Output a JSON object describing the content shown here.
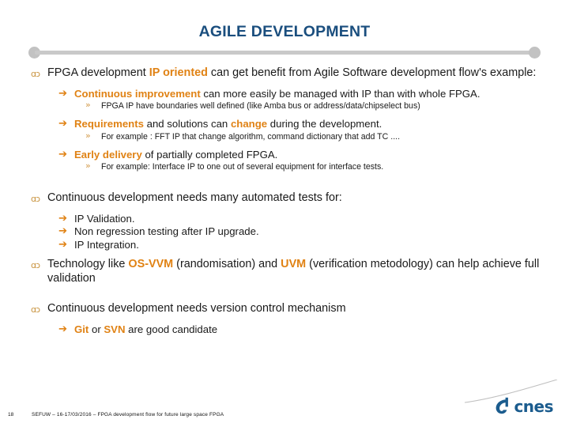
{
  "slide": {
    "title": "AGILE DEVELOPMENT",
    "page_number": "18",
    "footer_text": "SEFUW – 16-17/03/2016 – FPGA development flow for future large space FPGA"
  },
  "colors": {
    "title_blue": "#1A4E7E",
    "accent_orange": "#E08214",
    "bullet_gold": "#C8923C",
    "divider_gray": "#C9C9C9",
    "logo_blue": "#1B5C8E",
    "body_text": "#1A1A1A"
  },
  "icons": {
    "bullet_level1": "ɑɔ",
    "bullet_level2": "➔",
    "bullet_level3": "»"
  },
  "body": {
    "block1": {
      "lead_a": "FPGA development ",
      "lead_hl": "IP oriented",
      "lead_b": " can get benefit from  Agile Software development flow's example:",
      "items": [
        {
          "hl_lead": "Continuous improvement",
          "rest": " can more easily be managed with IP than with whole FPGA.",
          "sub": "FPGA IP have boundaries well defined (like Amba bus or address/data/chipselect bus)"
        },
        {
          "hl_lead": "Requirements",
          "mid": " and solutions can ",
          "hl_mid": "change",
          "rest": " during the development.",
          "sub": "For example : FFT IP that change algorithm, command dictionary that add TC ...."
        },
        {
          "hl_lead": "Early delivery",
          "rest": " of partially completed FPGA.",
          "sub": "For example: Interface IP to one out of several equipment for interface tests."
        }
      ]
    },
    "block2": {
      "lead": "Continuous development needs many automated tests for:",
      "items": [
        "IP Validation.",
        "Non regression testing after IP upgrade.",
        "IP Integration."
      ]
    },
    "block3": {
      "part_a": "Technology like ",
      "hl_a": "OS-VVM",
      "part_b": "  (randomisation) and ",
      "hl_b": "UVM",
      "part_c": " (verification metodology) can help achieve full validation"
    },
    "block4": {
      "lead": "Continuous development needs version control mechanism",
      "item_hl_a": "Git",
      "item_mid": " or ",
      "item_hl_b": "SVN",
      "item_rest": " are good candidate"
    }
  },
  "logo": {
    "word": "cnes"
  }
}
